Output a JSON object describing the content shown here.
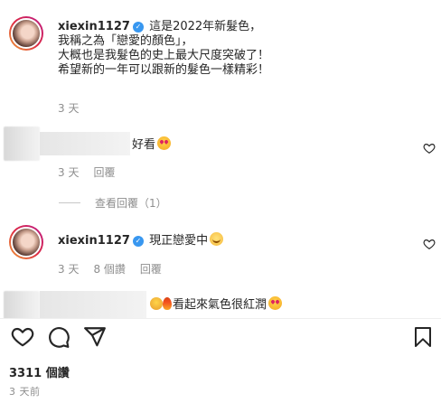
{
  "caption": {
    "username": "xiexin1127",
    "verified_icon": "verified-badge-icon",
    "lines": [
      "這是2022年新髮色，",
      "我稱之為「戀愛的顏色」，",
      "大概也是我髮色的史上最大尺度突破了！",
      "希望新的一年可以跟新的髮色一樣精彩！"
    ],
    "time": "3 天"
  },
  "comments": [
    {
      "text": "好看",
      "emoji": "heart-eyes-emoji",
      "time": "3 天",
      "reply_label": "回覆"
    },
    {
      "username": "xiexin1127",
      "text": "現正戀愛中",
      "emoji": "smiling-blush-emoji",
      "time": "3 天",
      "likes": "8 個讚",
      "reply_label": "回覆"
    },
    {
      "text": "看起來氣色很紅潤",
      "prefix_emojis": [
        "screaming-face-emoji",
        "fire-emoji"
      ],
      "emoji": "heart-eyes-emoji"
    }
  ],
  "view_replies": "查看回覆（1）",
  "actions": {
    "like_icon": "heart-icon",
    "comment_icon": "comment-icon",
    "share_icon": "paper-plane-icon",
    "save_icon": "bookmark-icon"
  },
  "likes": "3311 個讚",
  "posted": "3 天前",
  "colors": {
    "text": "#262626",
    "secondary": "#8e8e8e",
    "verified": "#3897f0",
    "emoji_heart": "#e0245e"
  }
}
